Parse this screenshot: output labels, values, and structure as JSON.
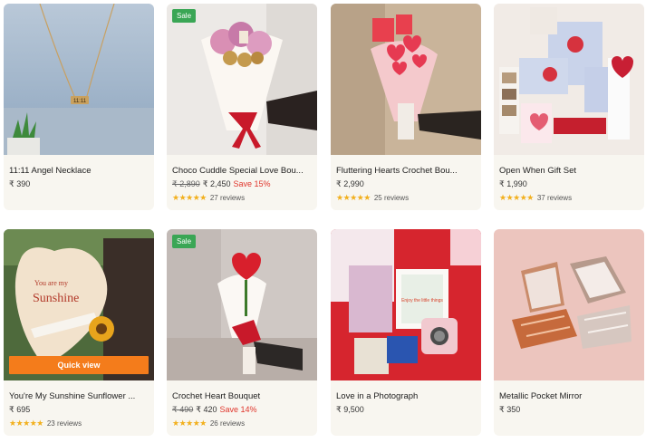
{
  "products": [
    {
      "title": "11:11 Angel Necklace",
      "price": "₹ 390",
      "old_price": "",
      "save": "",
      "reviews": "",
      "sale_badge": "",
      "quick_view": "",
      "necklace_tag": "11:11"
    },
    {
      "title": "Choco Cuddle Special Love Bou...",
      "price": "₹ 2,450",
      "old_price": "₹ 2,890",
      "save": "Save 15%",
      "reviews": "27 reviews",
      "sale_badge": "Sale",
      "quick_view": ""
    },
    {
      "title": "Fluttering Hearts Crochet Bou...",
      "price": "₹ 2,990",
      "old_price": "",
      "save": "",
      "reviews": "25 reviews",
      "sale_badge": "",
      "quick_view": ""
    },
    {
      "title": "Open When Gift Set",
      "price": "₹ 1,990",
      "old_price": "",
      "save": "",
      "reviews": "37 reviews",
      "sale_badge": "",
      "quick_view": ""
    },
    {
      "title": "You're My Sunshine Sunflower ...",
      "price": "₹ 695",
      "old_price": "",
      "save": "",
      "reviews": "23 reviews",
      "sale_badge": "",
      "quick_view": "Quick view",
      "card_text_1": "You are my",
      "card_text_2": "Sunshine"
    },
    {
      "title": "Crochet Heart Bouquet",
      "price": "₹ 420",
      "old_price": "₹ 490",
      "save": "Save 14%",
      "reviews": "26 reviews",
      "sale_badge": "Sale",
      "quick_view": ""
    },
    {
      "title": "Love in a Photograph",
      "price": "₹ 9,500",
      "old_price": "",
      "save": "",
      "reviews": "",
      "sale_badge": "",
      "quick_view": "",
      "frame_text": "Enjoy the little things"
    },
    {
      "title": "Metallic Pocket Mirror",
      "price": "₹ 350",
      "old_price": "",
      "save": "",
      "reviews": "",
      "sale_badge": "",
      "quick_view": ""
    }
  ],
  "rating_stars": "★★★★★",
  "colors": {
    "sale": "#3aa655",
    "quick_view": "#f47c1b",
    "save": "#e0352b",
    "star": "#f2b01e",
    "card_bg": "#f8f6f0"
  }
}
